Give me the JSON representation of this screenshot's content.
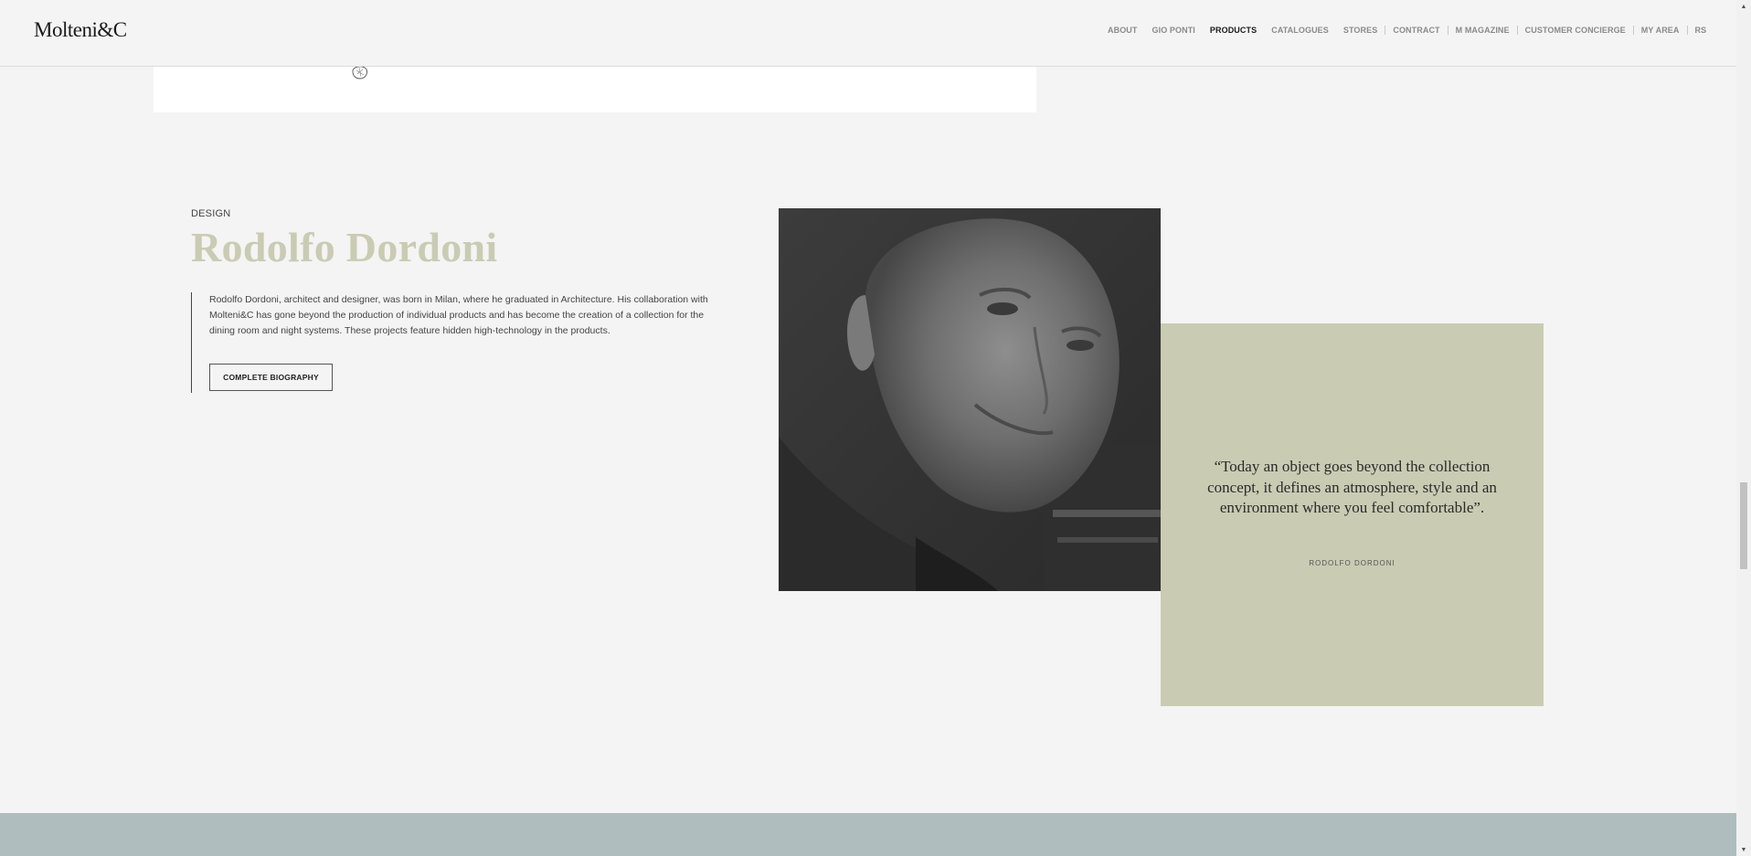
{
  "header": {
    "logo": "Molteni&C",
    "nav": [
      {
        "label": "ABOUT",
        "active": false
      },
      {
        "label": "GIO PONTI",
        "active": false
      },
      {
        "label": "PRODUCTS",
        "active": true
      },
      {
        "label": "CATALOGUES",
        "active": false
      },
      {
        "label": "STORES",
        "active": false
      },
      {
        "label": "CONTRACT",
        "active": false
      },
      {
        "label": "M MAGAZINE",
        "active": false
      },
      {
        "label": "CUSTOMER CONCIERGE",
        "active": false
      },
      {
        "label": "MY AREA",
        "active": false
      },
      {
        "label": "RS",
        "active": false
      }
    ]
  },
  "designer": {
    "eyebrow": "DESIGN",
    "name": "Rodolfo Dordoni",
    "bio": "Rodolfo Dordoni, architect and designer, was born in Milan, where he graduated in Architecture. His collaboration with Molteni&C has gone beyond the production of individual products and has become the creation of a collection for the dining room and night systems. These projects feature hidden high-technology in the products.",
    "button_label": "COMPLETE BIOGRAPHY"
  },
  "quote": {
    "text": "“Today an object goes beyond the collection concept, it defines an atmosphere, style and an environment where you feel comfortable”.",
    "author": "RODOLFO DORDONI"
  },
  "colors": {
    "accent_sage": "#c9ccb3",
    "band": "#afbdbe",
    "background": "#f4f4f4"
  },
  "icons": {
    "sketch": "sketch-icon",
    "portrait": "portrait-photo"
  }
}
